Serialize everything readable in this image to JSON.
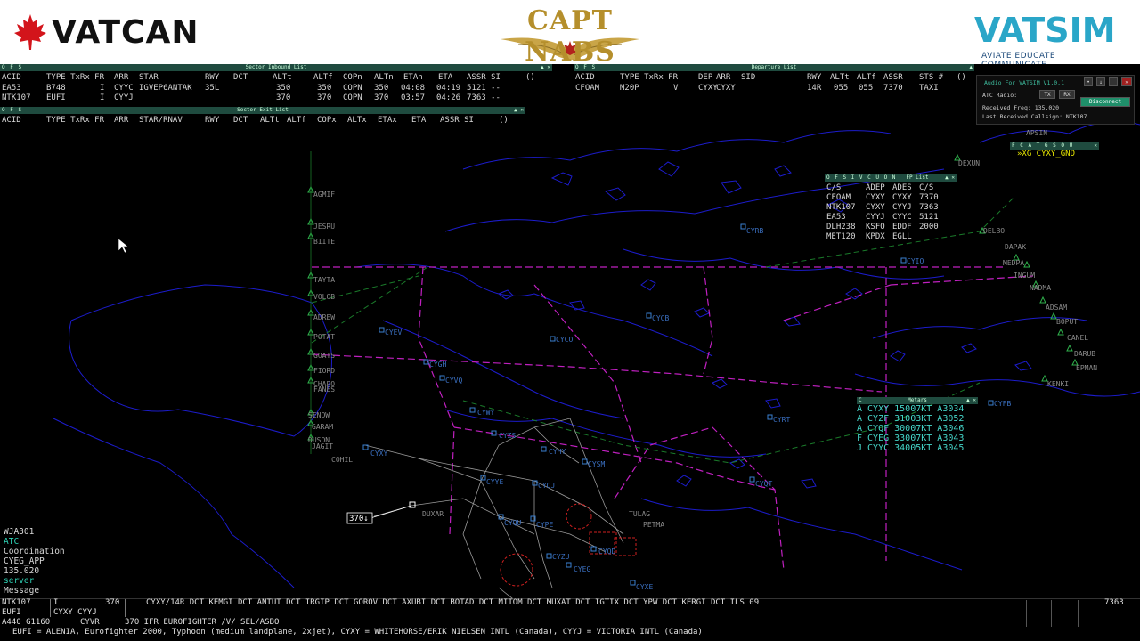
{
  "branding": {
    "left_logo": "VATCAN",
    "center_logo": "CAPT NABS",
    "right_logo": "VATSIM",
    "right_tagline": "AVIATE EDUCATE COMMUNICATE"
  },
  "windows": {
    "ofs": "O F S",
    "inbound": {
      "title": "Sector Inbound List",
      "headers": [
        "ACID",
        "TYPE TxRx FR",
        "ARR",
        "STAR",
        "RWY",
        "DCT",
        "ALTt",
        "ALTf",
        "COPn",
        "ALTn",
        "ETAn",
        "ETA",
        "ASSR SI",
        "()"
      ],
      "rows": [
        [
          "EA53",
          "B748",
          "I",
          "CYYC",
          "IGVEP6ANTAK",
          "35L",
          "",
          "350",
          "350",
          "COPN",
          "350",
          "04:08",
          "04:19",
          "5121 --"
        ],
        [
          "NTK107",
          "EUFI",
          "I",
          "CYYJ",
          "",
          "",
          "",
          "370",
          "370",
          "COPN",
          "370",
          "03:57",
          "04:26",
          "7363 --"
        ]
      ]
    },
    "exit": {
      "title": "Sector Exit List",
      "headers": [
        "ACID",
        "TYPE TxRx FR",
        "ARR",
        "STAR/RNAV",
        "RWY",
        "DCT",
        "ALTt",
        "ALTf",
        "COPx",
        "ALTx",
        "ETAx",
        "ETA",
        "ASSR SI",
        "()"
      ]
    },
    "departure": {
      "title": "Departure List",
      "headers": [
        "ACID",
        "TYPE TxRx FR",
        "DEP",
        "ARR",
        "SID",
        "RWY",
        "ALTt",
        "ALTf",
        "ASSR",
        "STS #",
        "()"
      ],
      "rows": [
        [
          "CFOAM",
          "M20P",
          "V",
          "CYXY",
          "CYXY",
          "",
          "14R",
          "055",
          "055",
          "7370",
          "TAXI"
        ]
      ]
    },
    "fplist": {
      "ofs": "O F S I V C U O N",
      "title": "FP List",
      "headers": [
        "C/S",
        "ADEP",
        "ADES",
        "C/S"
      ],
      "rows": [
        [
          "CFOAM",
          "CYXY",
          "CYXY",
          "7370"
        ],
        [
          "NTK107",
          "CYXY",
          "CYYJ",
          "7363"
        ],
        [
          "EA53",
          "CYYJ",
          "CYYC",
          "5121"
        ],
        [
          "DLH238",
          "KSFO",
          "EDDF",
          "2000"
        ],
        [
          "MET120",
          "KPDX",
          "EGLL",
          ""
        ]
      ]
    },
    "controllers": {
      "ofs": "F C A T G S O U",
      "entry": "»XG CYXY_GND"
    },
    "metars": {
      "ofs": "C",
      "title": "Metars",
      "rows": [
        "A CYXY 15007KT A3034",
        "A CYZF 31003KT A3052",
        "A CYQF 30007KT A3046",
        "F CYEG 33007KT A3043",
        "J CYYC 34005KT A3045"
      ]
    }
  },
  "audio": {
    "title": "Audio For VATSIM V1.0.1",
    "atc_radio_label": "ATC Radio:",
    "tx": "TX",
    "rx": "RX",
    "received_freq": "Received Freq: 135.020",
    "last_callsign": "Last Received Callsign: NTK107",
    "disconnect": "Disconnect"
  },
  "left_panel": {
    "callsign": "WJA301",
    "atc": "ATC",
    "coordination": "Coordination",
    "position": "CYEG_APP",
    "freq": "135.020",
    "server": "server",
    "message": "Message"
  },
  "track_label": "370↓",
  "fixes": [
    "AGMIF",
    "JESRU",
    "BIITE",
    "TAYTA",
    "VOLOB",
    "ADREW",
    "POTAT",
    "GOATS",
    "FIORD",
    "CHAPO",
    "FANES",
    "SENOW",
    "GARAM",
    "DUSON",
    "JAGIT",
    "COHIL",
    "DUXAR",
    "APSIN",
    "DEXUN",
    "DELBO",
    "DAPAK",
    "MEDPA",
    "INGUM",
    "NADMA",
    "ADSAM",
    "BOPUT",
    "CANEL",
    "DARUB",
    "EPMAN",
    "KENKI",
    "PETMA",
    "TULAG"
  ],
  "airports": [
    "CYRB",
    "CYIO",
    "CYCB",
    "CYEV",
    "CYCO",
    "CYGH",
    "CYVQ",
    "CYWY",
    "CYZS",
    "CYHY",
    "CYSM",
    "CYOJ",
    "CYYE",
    "CYXY",
    "CYPE",
    "CYQU",
    "CYZU",
    "CYQD",
    "CYEG",
    "CYXE",
    "CYRT",
    "CYFB",
    "CYQT"
  ],
  "bottom": {
    "line1_cs": "NTK107",
    "line1_fr": "I",
    "line1_alt": "370",
    "route": "CYXY/14R DCT KEMGI DCT ANTUT DCT IRGIP DCT GOROV DCT AXUBI DCT BOTAD DCT MITOM DCT MUXAT DCT IGTIX DCT YPW DCT KERGI DCT ILS 09",
    "squawk": "7363",
    "line2_type": "EUFI",
    "line2_pair": "CYXY CYYJ",
    "line3_a": "A440 G1160",
    "line3_b": "CYVR",
    "line3_c": "370 IFR EUROFIGHTER /V/ SEL/ASBO",
    "line4": "EUFI = ALENIA, Eurofighter 2000, Typhoon (medium landplane, 2xjet), CYXY = WHITEHORSE/ERIK NIELSEN INTL (Canada), CYYJ = VICTORIA INTL (Canada)"
  },
  "colors": {
    "coast": "#1c1ccc",
    "airspace": "#c020c0",
    "airway": "#1a7a2a",
    "route_line": "#9a9a9a",
    "panel_bar": "#1f4b3f"
  }
}
